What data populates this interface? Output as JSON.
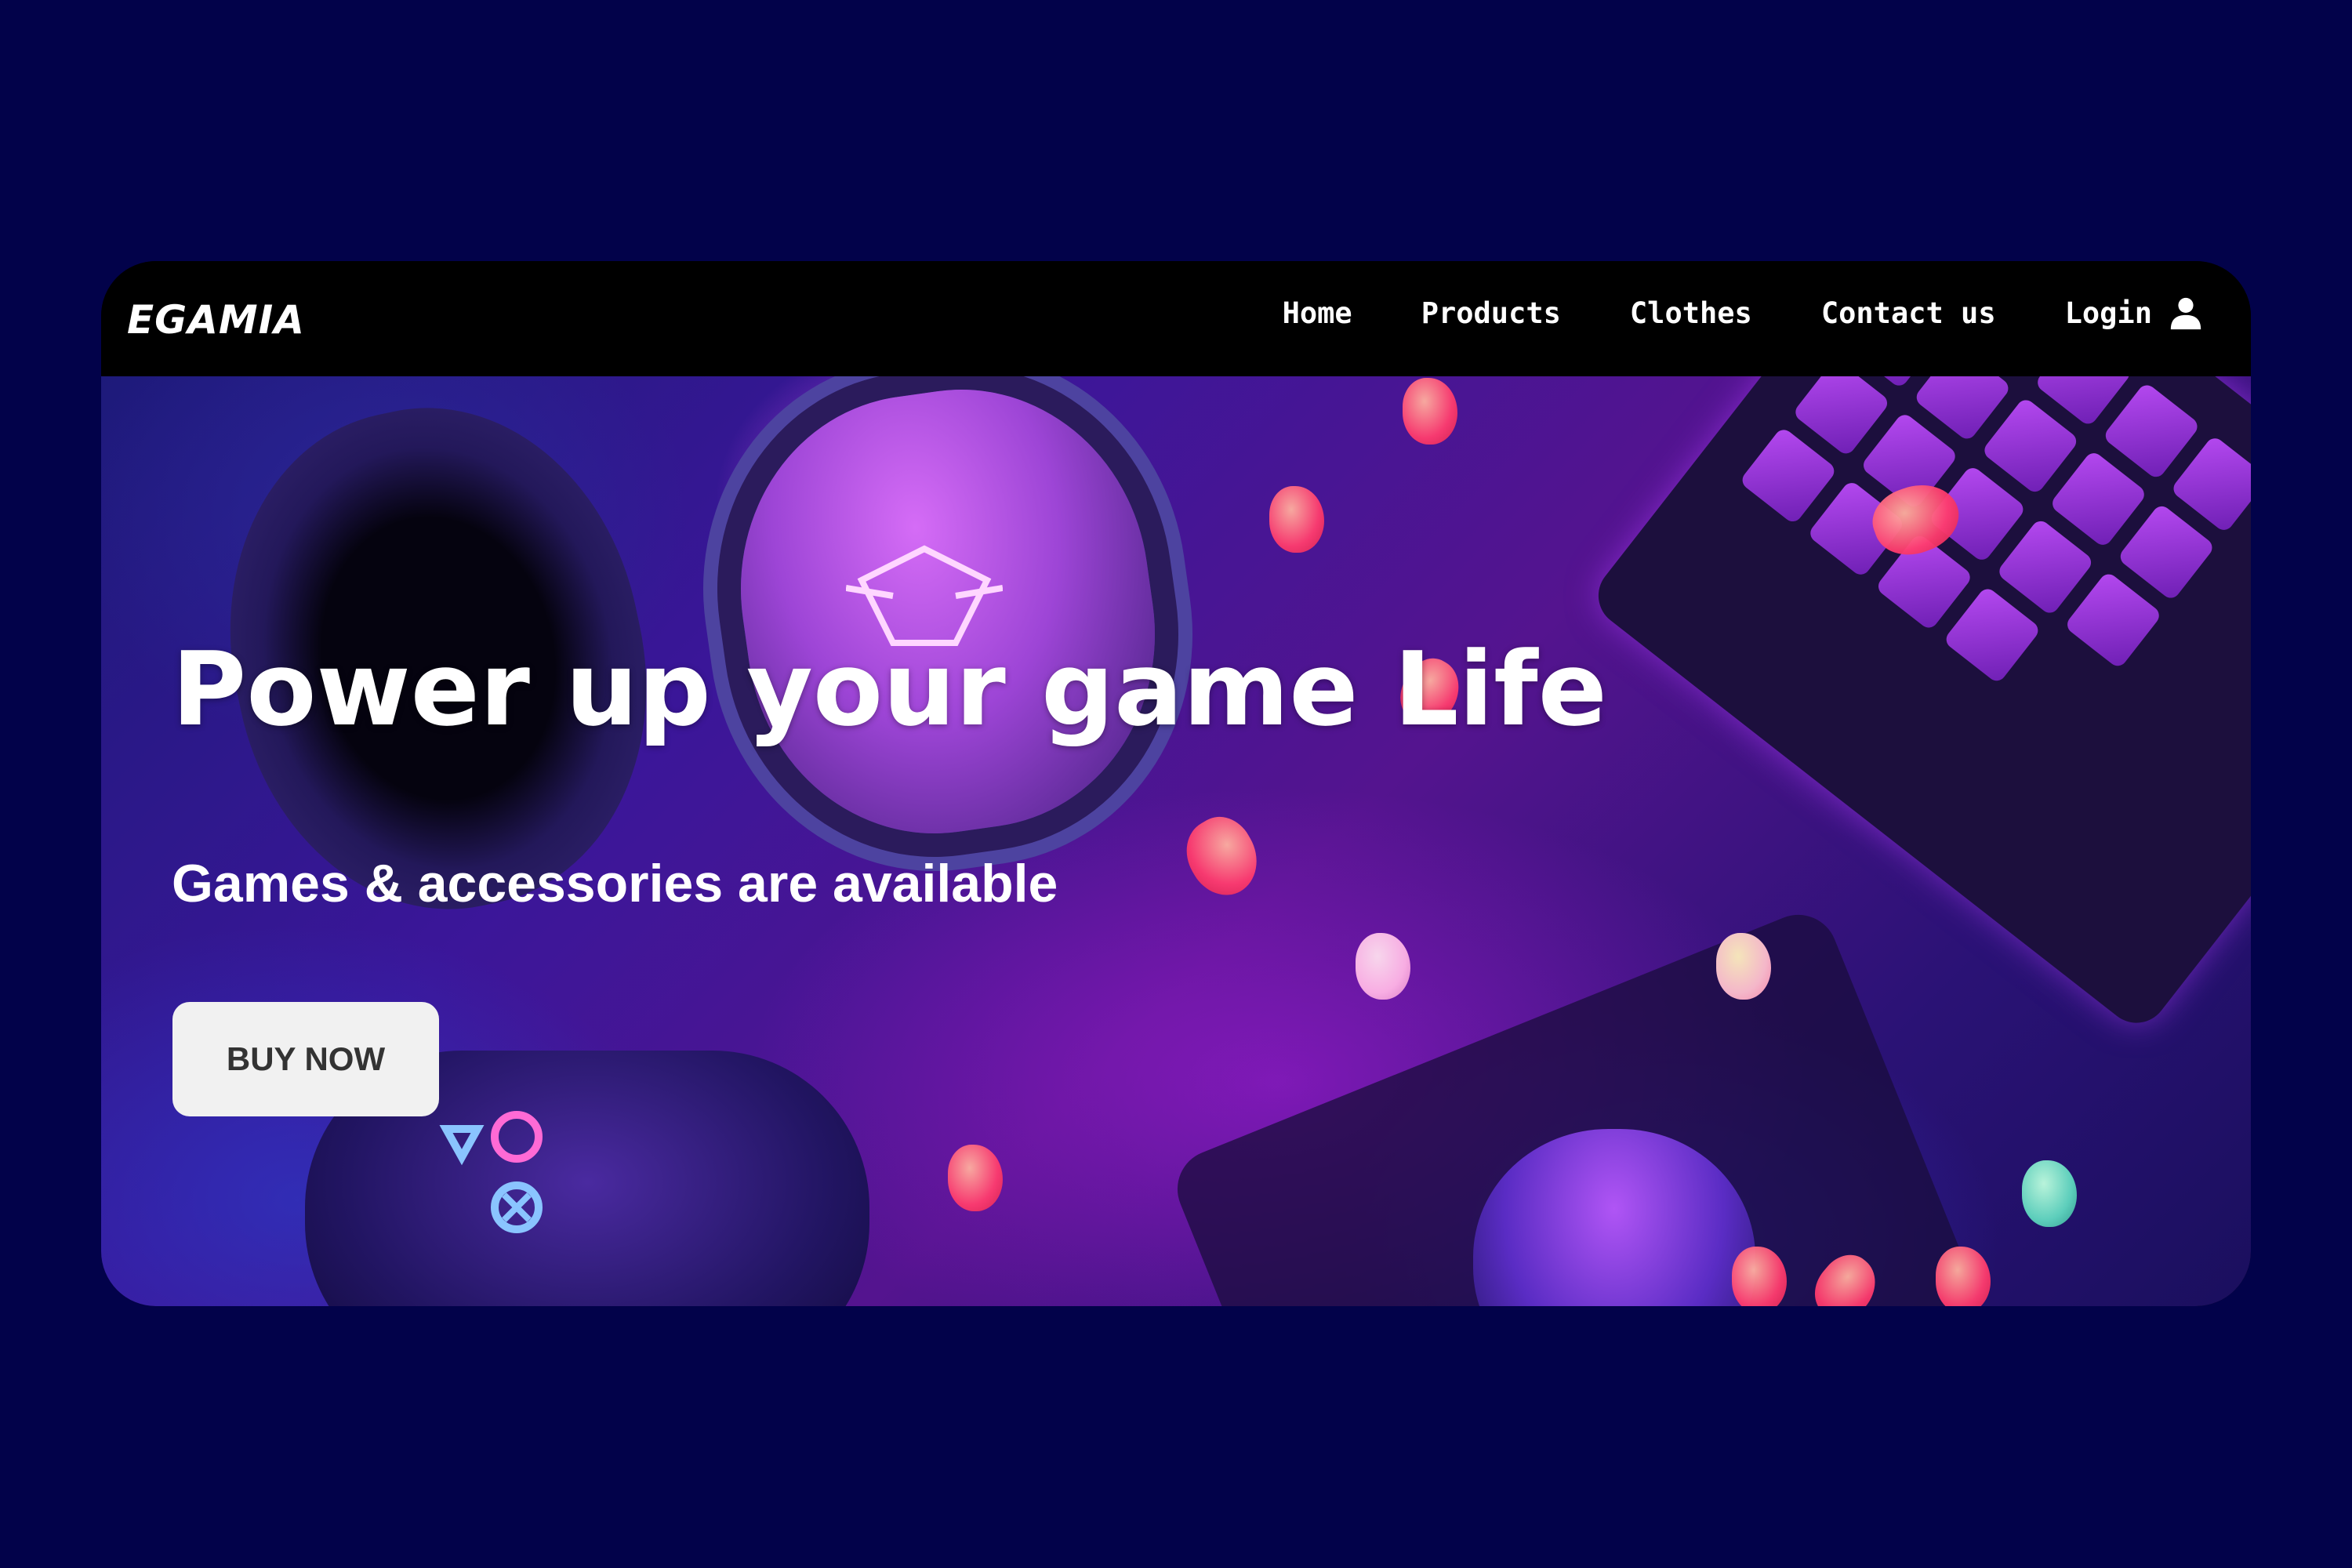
{
  "navbar": {
    "logo": "EGAMIA",
    "items": [
      {
        "label": "Home"
      },
      {
        "label": "Products"
      },
      {
        "label": "Clothes"
      },
      {
        "label": "Contact us"
      }
    ],
    "login_label": "Login",
    "login_icon": "user-icon"
  },
  "hero": {
    "headline": "Power up your game Life",
    "subheadline": "Games & accessories are available",
    "cta_label": "BUY NOW",
    "image": "gaming-setup-background"
  },
  "colors": {
    "page_background": "#02024a",
    "navbar_background": "#000000",
    "text": "#ffffff",
    "button_background": "#f1f1f1",
    "button_text": "#333333",
    "accent_purple": "#9d45d6",
    "accent_pink": "#ff3c6e"
  }
}
